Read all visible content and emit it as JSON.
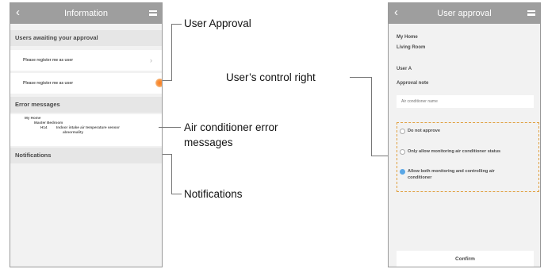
{
  "left_screen": {
    "title": "Information",
    "sections": {
      "approval": "Users awaiting your approval",
      "errors": "Error messages",
      "notifications": "Notifications"
    },
    "approval_items": [
      "Please register me as user",
      "Please register me as user"
    ],
    "error": {
      "home": "My Home",
      "room": "Master Bedroom",
      "code": "H14",
      "message_line1": "Indoor intake air temperature sensor",
      "message_line2": "abnormality"
    }
  },
  "right_screen": {
    "title": "User approval",
    "home": "My Home",
    "room": "Living Room",
    "user": "User A",
    "approval_note_label": "Approval note",
    "approval_note_placeholder": "Air conditioner name",
    "options": [
      {
        "label": "Do not approve",
        "selected": false
      },
      {
        "label": "Only allow monitoring air conditioner status",
        "selected": false
      },
      {
        "label_line1": "Allow both monitoring and controlling air",
        "label_line2": "conditioner",
        "selected": true
      }
    ],
    "confirm_label": "Confirm"
  },
  "annotations": {
    "user_approval": "User Approval",
    "error_messages_line1": "Air conditioner error",
    "error_messages_line2": "messages",
    "notifications": "Notifications",
    "control_right": "User’s control right"
  },
  "colors": {
    "titlebar": "#9e9e9e",
    "highlight_dot": "#ff7a1a",
    "dashed_box": "#e0a040",
    "radio_selected": "#5aa7e6"
  }
}
